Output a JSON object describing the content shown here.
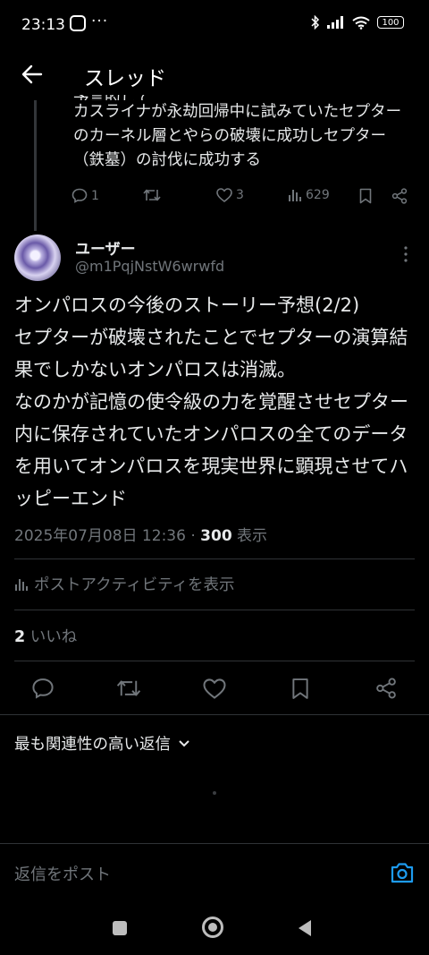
{
  "status_bar": {
    "time": "23:13",
    "dots": "···",
    "battery": "100"
  },
  "header": {
    "title": "スレッド"
  },
  "previous_post": {
    "text_cut": "予言的して、",
    "text": "カスライナが永劫回帰中に試みていたセプターのカーネル層とやらの破壊に成功しセプター（鉄墓）の討伐に成功する",
    "replies": "1",
    "likes": "3",
    "views": "629"
  },
  "post": {
    "author_name": "ユーザー",
    "author_handle": "@m1PqjNstW6wrwfd",
    "body": "オンパロスの今後のストーリー予想(2/2)\nセプターが破壊されたことでセプターの演算結果でしかないオンパロスは消滅。\nなのかが記憶の使令級の力を覚醒させセプター内に保存されていたオンパロスの全てのデータを用いてオンパロスを現実世界に顕現させてハッピーエンド",
    "date": "2025年07月08日 12:36",
    "separator": " · ",
    "views": "300",
    "views_label": " 表示"
  },
  "activity_link": "ポストアクティビティを表示",
  "likes": {
    "count": "2",
    "label": " いいね"
  },
  "sort": {
    "label": "最も関連性の高い返信"
  },
  "reply": {
    "placeholder": "返信をポスト"
  },
  "colors": {
    "accent": "#1d9bf0",
    "muted": "#71767b",
    "text": "#e7e9ea",
    "divider": "#2f3336"
  }
}
